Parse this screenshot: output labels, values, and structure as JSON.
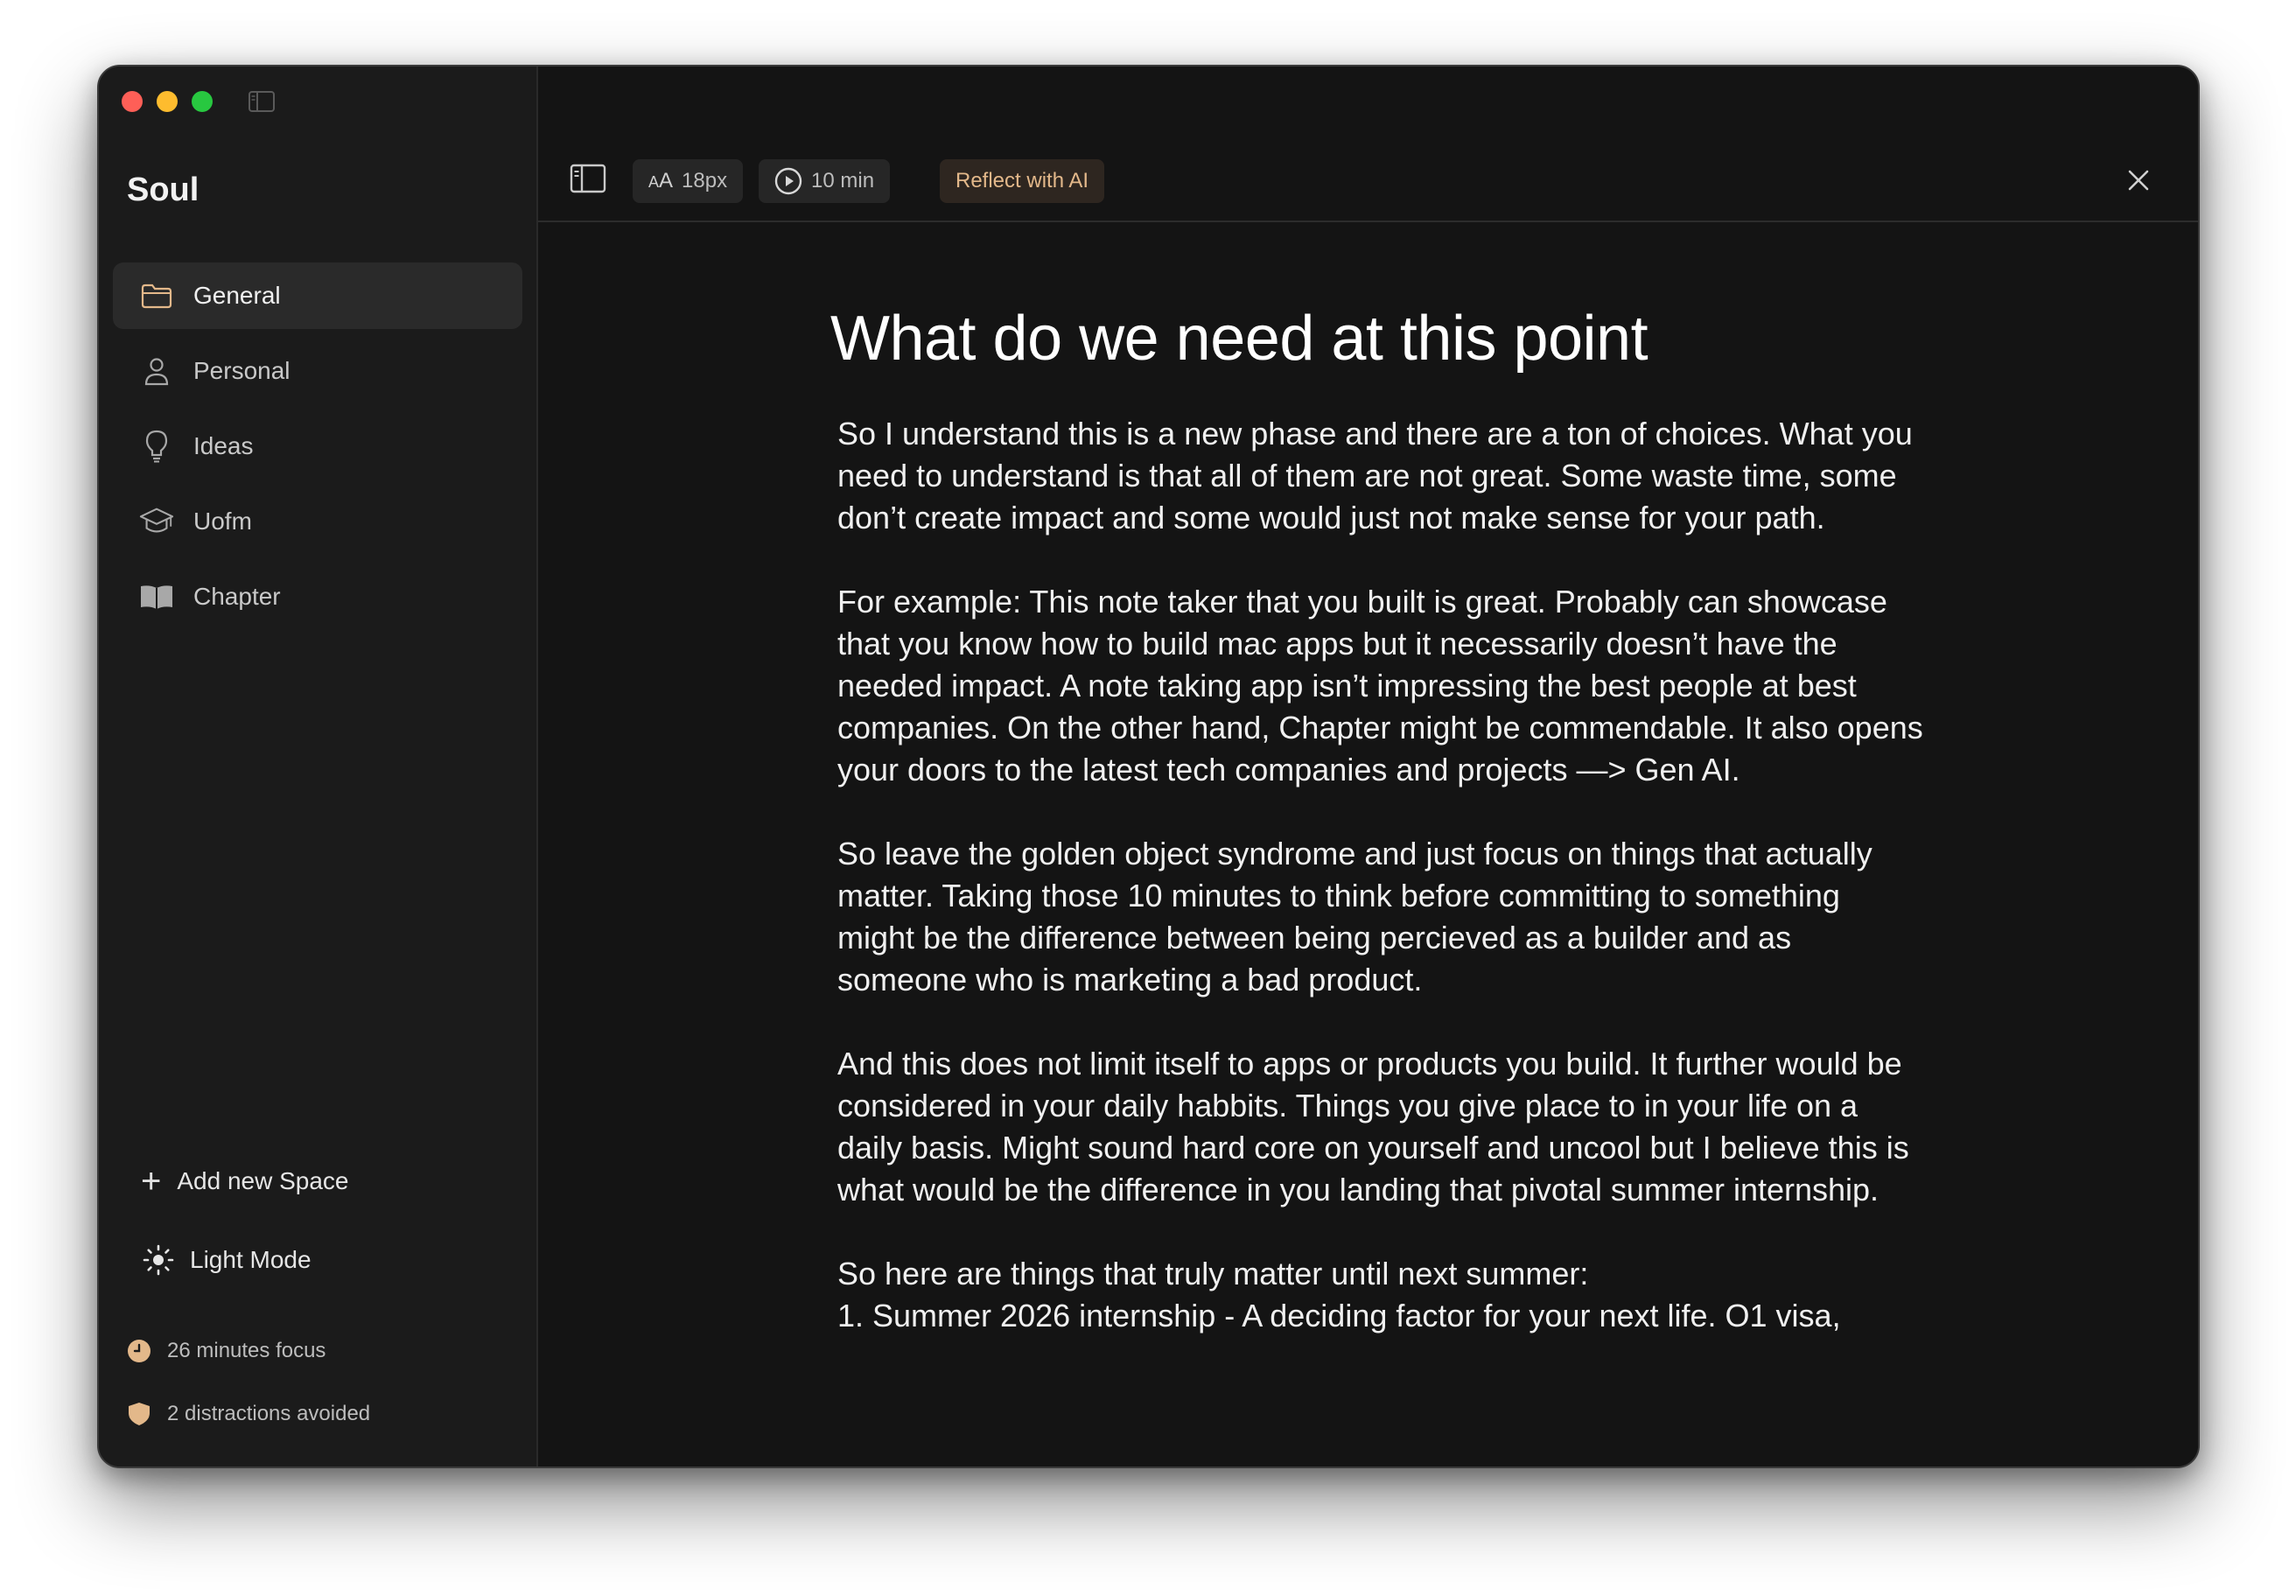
{
  "app": {
    "title": "Soul"
  },
  "sidebar": {
    "items": [
      {
        "label": "General",
        "icon": "folder-icon",
        "active": true
      },
      {
        "label": "Personal",
        "icon": "person-icon",
        "active": false
      },
      {
        "label": "Ideas",
        "icon": "lightbulb-icon",
        "active": false
      },
      {
        "label": "Uofm",
        "icon": "graduation-cap-icon",
        "active": false
      },
      {
        "label": "Chapter",
        "icon": "book-icon",
        "active": false
      }
    ],
    "add_space_label": "Add new Space",
    "theme_toggle_label": "Light Mode",
    "stats": {
      "focus": "26 minutes focus",
      "distractions": "2 distractions avoided"
    }
  },
  "toolbar": {
    "font_size": "18px",
    "font_glyph_small": "A",
    "font_glyph_large": "A",
    "timer": "10 min",
    "ai_button": "Reflect with AI"
  },
  "document": {
    "title": "What do we need at this point",
    "paragraphs": [
      "So I understand this is a new phase and there are a ton of choices. What you need to understand is that all of them are not great. Some waste time, some don’t create impact and some would just not make sense for your path.",
      "For example: This note taker that you built is great. Probably can showcase that you know how to build mac apps but it necessarily doesn’t have the needed impact. A note taking app isn’t impressing the best people at best companies. On the other hand, Chapter might be commendable. It also opens your doors to the latest tech companies and projects —> Gen AI.",
      "So leave the golden object syndrome and just focus on things that actually matter. Taking those 10 minutes to think before committing to something might be the difference between being percieved as a builder and as someone who is marketing a bad product.",
      "And this does not limit itself to apps or products you build. It further would be considered in your daily habbits. Things you give place to in your life on a daily basis.  Might sound hard core on yourself and uncool but I believe this is what would be the difference in you landing that pivotal summer internship.",
      "So here are things that truly matter until next summer:",
      "1. Summer 2026 internship - A deciding factor for your next life. O1 visa,"
    ]
  },
  "colors": {
    "accent": "#e3b88a",
    "window_bg": "#141414",
    "sidebar_bg": "#1b1b1b"
  }
}
